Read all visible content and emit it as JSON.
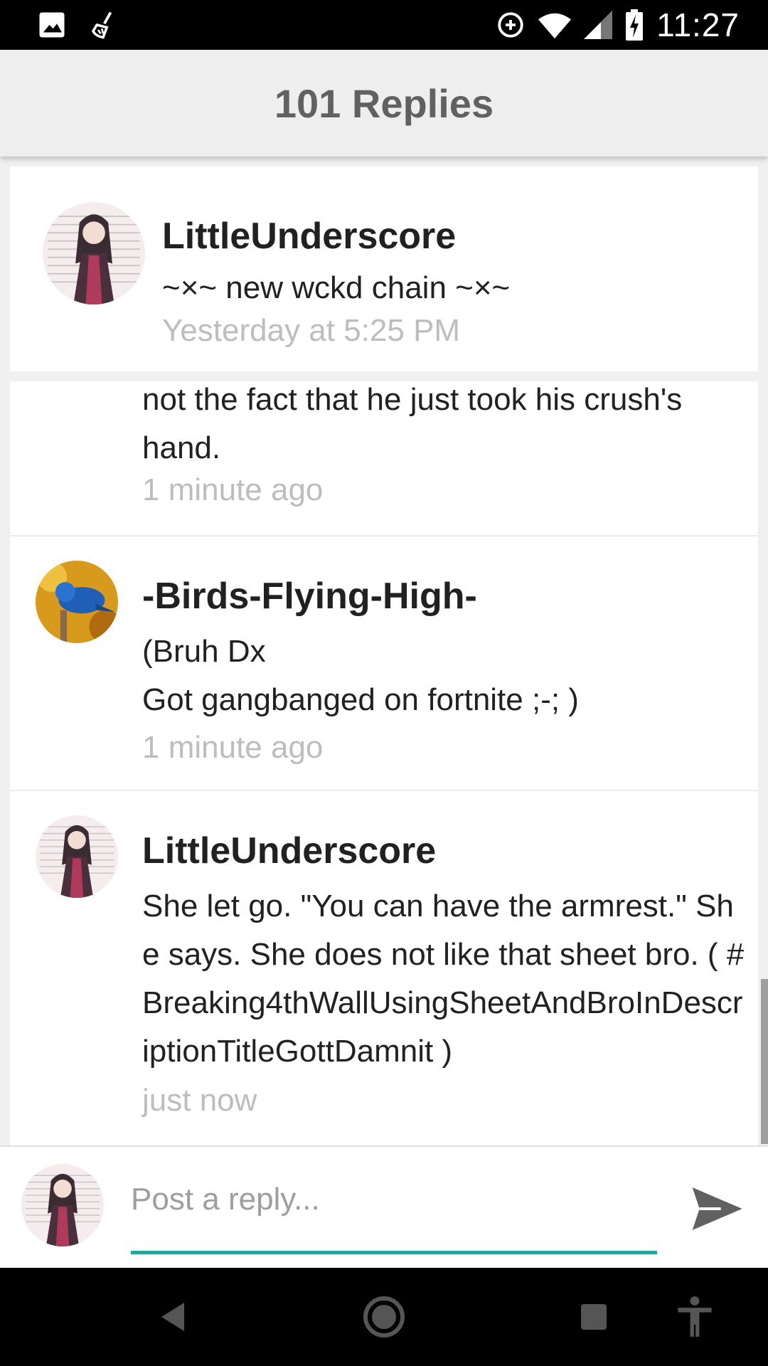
{
  "status_bar": {
    "time": "11:27",
    "icons": [
      "image-icon",
      "broom-icon",
      "data-saver-icon",
      "wifi-icon",
      "signal-icon",
      "battery-charging-icon"
    ]
  },
  "header": {
    "title": "101 Replies"
  },
  "original_post": {
    "author": "LittleUnderscore",
    "title": "~×~ new wckd chain ~×~",
    "timestamp": "Yesterday at 5:25 PM"
  },
  "replies": [
    {
      "text": "not the fact that he just took his crush's\nhand.",
      "timestamp": "1 minute ago"
    },
    {
      "author": "-Birds-Flying-High-",
      "text": "(Bruh Dx\nGot gangbanged on fortnite ;-; )",
      "timestamp": "1 minute ago"
    },
    {
      "author": "LittleUnderscore",
      "text": "She let go. \"You can have the armrest.\" She says. She does not like that sheet bro. ( #Breaking4thWallUsingSheetAndBroInDescriptionTitleGottDamnit )",
      "timestamp": "just now"
    }
  ],
  "composer": {
    "placeholder": "Post a reply..."
  },
  "nav_bar": {
    "icons": [
      "back-icon",
      "home-icon",
      "recents-icon",
      "accessibility-icon"
    ]
  },
  "colors": {
    "accent": "#26a69a",
    "timestamp": "#bdbdbd",
    "app_bar": "#eeeeee"
  }
}
